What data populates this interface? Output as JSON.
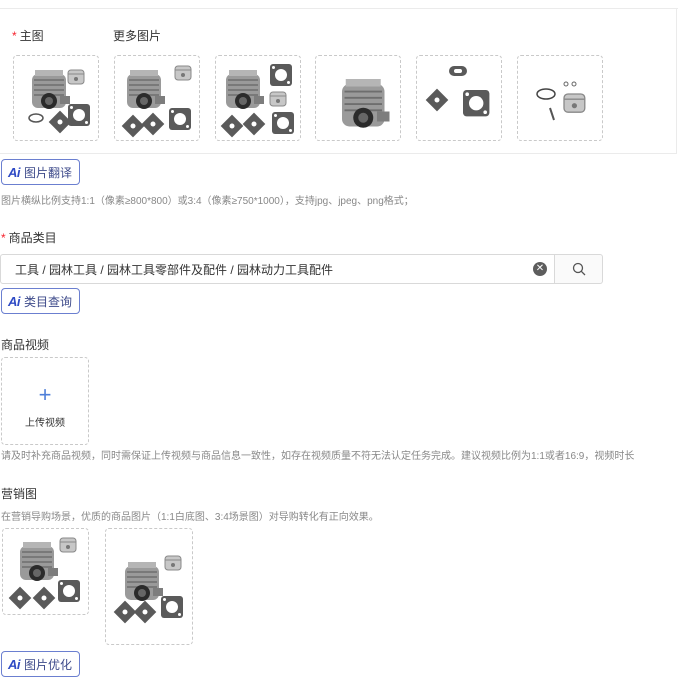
{
  "main_image": {
    "label": "主图",
    "required_mark": "*"
  },
  "more_images": {
    "label": "更多图片"
  },
  "thumbnails": [
    {
      "kind": "cylinder-kit"
    },
    {
      "kind": "cylinder-kit"
    },
    {
      "kind": "cylinder-kit"
    },
    {
      "kind": "cylinder"
    },
    {
      "kind": "gaskets"
    },
    {
      "kind": "piston"
    }
  ],
  "image_translate_button": {
    "ai": "Ai",
    "label": "图片翻译"
  },
  "image_hint": "图片横纵比例支持1:1（像素≥800*800）或3:4（像素≥750*1000），支持jpg、jpeg、png格式；",
  "category": {
    "required_mark": "*",
    "label": "商品类目",
    "value": "工具 / 园林工具 / 园林工具零部件及配件 / 园林动力工具配件",
    "clear_symbol": "✕"
  },
  "category_query_button": {
    "ai": "Ai",
    "label": "类目查询"
  },
  "video": {
    "label": "商品视频",
    "upload_plus": "+",
    "upload_label": "上传视频",
    "hint": "请及时补充商品视频，同时需保证上传视频与商品信息一致性，如存在视频质量不符无法认定任务完成。建议视频比例为1:1或者16:9，视频时长"
  },
  "marketing": {
    "label": "营销图",
    "hint": "在营销导购场景，优质的商品图片（1:1白底图、3:4场景图）对导购转化有正向效果。"
  },
  "marketing_images": [
    {
      "kind": "cylinder-kit"
    },
    {
      "kind": "cylinder-kit-tall"
    }
  ],
  "image_optimize_button": {
    "ai": "Ai",
    "label": "图片优化"
  },
  "colors": {
    "required": "#f5222d",
    "ai_border": "#6b7fd0",
    "ai_text": "#2f4bc5",
    "plus": "#4e7fd9"
  }
}
